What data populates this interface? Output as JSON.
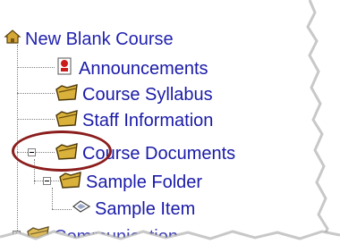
{
  "tree": {
    "root": {
      "label": "New Blank Course",
      "icon": "home-folder-icon"
    },
    "items": [
      {
        "label": "Announcements",
        "icon": "announcements-icon"
      },
      {
        "label": "Course Syllabus",
        "icon": "folder-icon"
      },
      {
        "label": "Staff Information",
        "icon": "folder-icon"
      },
      {
        "label": "Course Documents",
        "icon": "folder-icon",
        "expanded": true
      },
      {
        "label": "Sample Folder",
        "icon": "folder-icon",
        "expanded": true
      },
      {
        "label": "Sample Item",
        "icon": "item-icon"
      },
      {
        "label": "Communication",
        "icon": "folder-icon",
        "expanded": false
      }
    ]
  },
  "colors": {
    "link": "#1a1aa8",
    "highlight_ellipse": "#8b1d1d",
    "folder": "#c9a227"
  }
}
